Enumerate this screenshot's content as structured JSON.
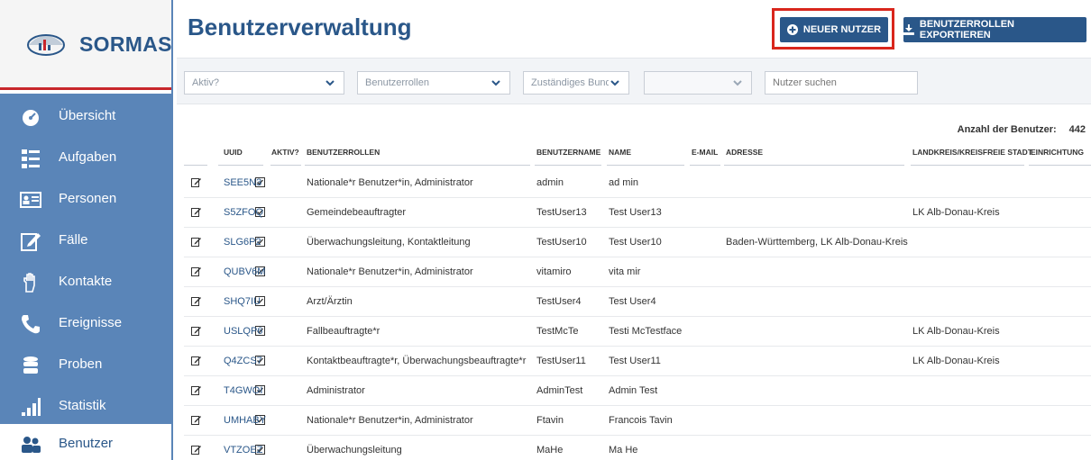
{
  "app": {
    "name": "SORMAS"
  },
  "nav": [
    {
      "label": "Übersicht",
      "icon": "gauge-icon"
    },
    {
      "label": "Aufgaben",
      "icon": "tasks-icon"
    },
    {
      "label": "Personen",
      "icon": "id-card-icon"
    },
    {
      "label": "Fälle",
      "icon": "edit-square-icon"
    },
    {
      "label": "Kontakte",
      "icon": "hand-icon"
    },
    {
      "label": "Ereignisse",
      "icon": "phone-icon"
    },
    {
      "label": "Proben",
      "icon": "database-icon"
    },
    {
      "label": "Statistik",
      "icon": "bar-chart-icon"
    },
    {
      "label": "Benutzer",
      "icon": "users-icon",
      "active": true
    }
  ],
  "header": {
    "title": "Benutzerverwaltung",
    "new_user_label": "NEUER NUTZER",
    "export_label": "BENUTZERROLLEN EXPORTIEREN"
  },
  "filters": {
    "active_placeholder": "Aktiv?",
    "roles_placeholder": "Benutzerrollen",
    "state_placeholder": "Zuständiges Bund",
    "other_placeholder": "",
    "search_placeholder": "Nutzer suchen"
  },
  "count": {
    "label": "Anzahl der Benutzer:",
    "value": "442"
  },
  "table": {
    "columns": [
      "UUID",
      "AKTIV?",
      "BENUTZERROLLEN",
      "BENUTZERNAME",
      "NAME",
      "E-MAIL",
      "ADRESSE",
      "LANDKREIS/KREISFREIE STADT",
      "EINRICHTUNG"
    ],
    "rows": [
      {
        "uuid": "SEE5N3",
        "roles": "Nationale*r Benutzer*in, Administrator",
        "username": "admin",
        "name": "ad min",
        "email": "",
        "address": "",
        "district": "",
        "facility": ""
      },
      {
        "uuid": "S5ZFOQ",
        "roles": "Gemeindebeauftragter",
        "username": "TestUser13",
        "name": "Test User13",
        "email": "",
        "address": "",
        "district": "LK Alb-Donau-Kreis",
        "facility": ""
      },
      {
        "uuid": "SLG6P2",
        "roles": "Überwachungsleitung, Kontaktleitung",
        "username": "TestUser10",
        "name": "Test User10",
        "email": "",
        "address": "Baden-Württemberg, LK Alb-Donau-Kreis",
        "district": "",
        "facility": ""
      },
      {
        "uuid": "QUBV6M",
        "roles": "Nationale*r Benutzer*in, Administrator",
        "username": "vitamiro",
        "name": "vita mir",
        "email": "",
        "address": "",
        "district": "",
        "facility": ""
      },
      {
        "uuid": "SHQ7IU",
        "roles": "Arzt/Ärztin",
        "username": "TestUser4",
        "name": "Test User4",
        "email": "",
        "address": "",
        "district": "",
        "facility": ""
      },
      {
        "uuid": "USLQP6",
        "roles": "Fallbeauftragte*r",
        "username": "TestMcTe",
        "name": "Testi McTestface",
        "email": "",
        "address": "",
        "district": "LK Alb-Donau-Kreis",
        "facility": ""
      },
      {
        "uuid": "Q4ZCS7",
        "roles": "Kontaktbeauftragte*r, Überwachungsbeauftragte*r",
        "username": "TestUser11",
        "name": "Test User11",
        "email": "",
        "address": "",
        "district": "LK Alb-Donau-Kreis",
        "facility": ""
      },
      {
        "uuid": "T4GWOI",
        "roles": "Administrator",
        "username": "AdminTest",
        "name": "Admin Test",
        "email": "",
        "address": "",
        "district": "",
        "facility": ""
      },
      {
        "uuid": "UMHABY",
        "roles": "Nationale*r Benutzer*in, Administrator",
        "username": "Ftavin",
        "name": "Francois Tavin",
        "email": "",
        "address": "",
        "district": "",
        "facility": ""
      },
      {
        "uuid": "VTZOEZ",
        "roles": "Überwachungsleitung",
        "username": "MaHe",
        "name": "Ma He",
        "email": "",
        "address": "",
        "district": "",
        "facility": ""
      }
    ]
  }
}
